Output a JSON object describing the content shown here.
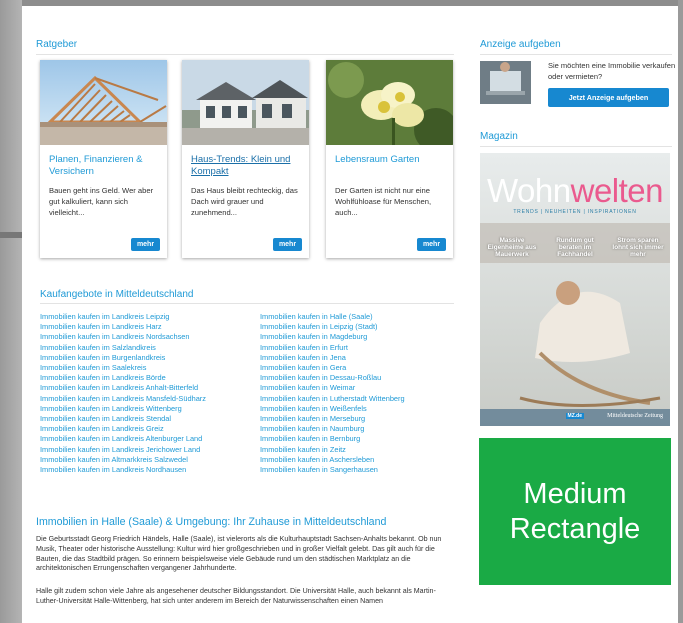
{
  "ratgeber": {
    "title": "Ratgeber",
    "cards": [
      {
        "title": "Planen, Finanzieren & Versichern",
        "text": "Bauen geht ins Geld. Wer aber gut kalkuliert, kann sich vielleicht...",
        "more": "mehr"
      },
      {
        "title": "Haus-Trends: Klein und Kompakt",
        "text": "Das Haus bleibt rechteckig, das Dach wird grauer und zunehmend...",
        "more": "mehr"
      },
      {
        "title": "Lebensraum Garten",
        "text": "Der Garten ist nicht nur eine Wohlfühloase für Menschen, auch...",
        "more": "mehr"
      }
    ]
  },
  "kaufangebote": {
    "title": "Kaufangebote in Mitteldeutschland",
    "left": [
      "Immobilien kaufen im Landkreis Leipzig",
      "Immobilien kaufen im Landkreis Harz",
      "Immobilien kaufen im Landkreis Nordsachsen",
      "Immobilien kaufen im Salzlandkreis",
      "Immobilien kaufen im Burgenlandkreis",
      "Immobilien kaufen im Saalekreis",
      "Immobilien kaufen im Landkreis Börde",
      "Immobilien kaufen im Landkreis Anhalt-Bitterfeld",
      "Immobilien kaufen im Landkreis Mansfeld-Südharz",
      "Immobilien kaufen im Landkreis Wittenberg",
      "Immobilien kaufen im Landkreis Stendal",
      "Immobilien kaufen im Landkreis Greiz",
      "Immobilien kaufen im Landkreis Altenburger Land",
      "Immobilien kaufen im Landkreis Jerichower Land",
      "Immobilien kaufen im Altmarkkreis Salzwedel",
      "Immobilien kaufen im Landkreis Nordhausen"
    ],
    "right": [
      "Immobilien kaufen in Halle (Saale)",
      "Immobilien kaufen in Leipzig (Stadt)",
      "Immobilien kaufen in Magdeburg",
      "Immobilien kaufen in Erfurt",
      "Immobilien kaufen in Jena",
      "Immobilien kaufen in Gera",
      "Immobilien kaufen in Dessau-Roßlau",
      "Immobilien kaufen in Weimar",
      "Immobilien kaufen in Lutherstadt Wittenberg",
      "Immobilien kaufen in Weißenfels",
      "Immobilien kaufen in Merseburg",
      "Immobilien kaufen in Naumburg",
      "Immobilien kaufen in Bernburg",
      "Immobilien kaufen in Zeitz",
      "Immobilien kaufen in Aschersleben",
      "Immobilien kaufen in Sangerhausen"
    ]
  },
  "article": {
    "heading": "Immobilien in Halle (Saale) & Umgebung: Ihr Zuhause in Mitteldeutschland",
    "p1": "Die Geburtsstadt Georg Friedrich Händels, Halle (Saale), ist vielerorts als die Kulturhauptstadt Sachsen-Anhalts bekannt. Ob nun Musik, Theater oder historische Ausstellung: Kultur wird hier großgeschrieben und in großer Vielfalt gelebt. Das gilt auch für die Bauten, die das Stadtbild prägen. So erinnern beispielsweise viele Gebäude rund um den städtischen Marktplatz an die architektonischen Errungenschaften vergangener Jahrhunderte.",
    "p2": "Halle gilt zudem schon viele Jahre als angesehener deutscher Bildungsstandort. Die Universität Halle, auch bekannt als Martin-Luther-Universität Halle-Wittenberg, hat sich unter anderem im Bereich der Naturwissenschaften einen Namen"
  },
  "sidebar": {
    "ad_title": "Anzeige aufgeben",
    "ad_text": "Sie möchten eine Immobilie verkaufen oder vermieten?",
    "ad_button": "Jetzt Anzeige aufgeben",
    "magazin_title": "Magazin",
    "mag_word_1": "Wohn",
    "mag_word_2": "welten",
    "mag_sub": "TRENDS | NEUHEITEN | INSPIRATIONEN",
    "mag_col1": "Massive Eigenheime aus Mauerwerk",
    "mag_col2": "Rundum gut beraten im Fachhandel",
    "mag_col3": "Strom sparen lohnt sich immer mehr",
    "mag_brand": "Mitteldeutsche Zeitung",
    "mag_badge": "MZ.de",
    "med_rect": "Medium\nRectangle"
  },
  "colors": {
    "accent": "#1f9ad6",
    "button": "#1788d0",
    "ad_green": "#1aaa45",
    "mag_pink": "#ea5a8e"
  }
}
